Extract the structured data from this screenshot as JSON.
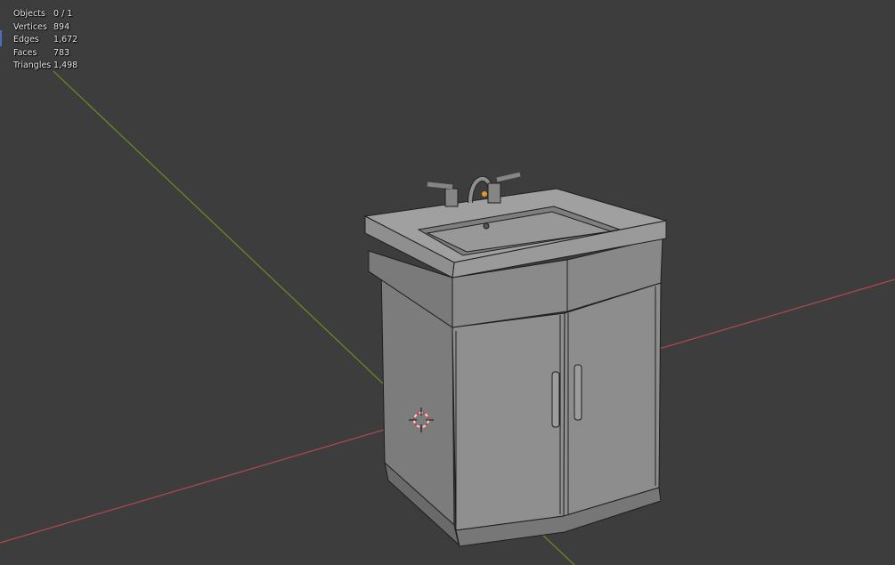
{
  "stats": {
    "rows": [
      {
        "label": "Objects",
        "value": "0 / 1"
      },
      {
        "label": "Vertices",
        "value": "894"
      },
      {
        "label": "Edges",
        "value": "1,672"
      },
      {
        "label": "Faces",
        "value": "783"
      },
      {
        "label": "Triangles",
        "value": "1,498"
      }
    ]
  },
  "colors": {
    "background": "#3d3d3d",
    "x_axis": "#b3484f",
    "y_axis": "#6b8e23",
    "mesh_fill": "#8a8a8a",
    "mesh_wire": "#1e1e1e",
    "cursor_red": "#d33",
    "accent_blue": "#4b6fb8"
  },
  "icons": {
    "cursor": "3d-cursor-icon"
  }
}
